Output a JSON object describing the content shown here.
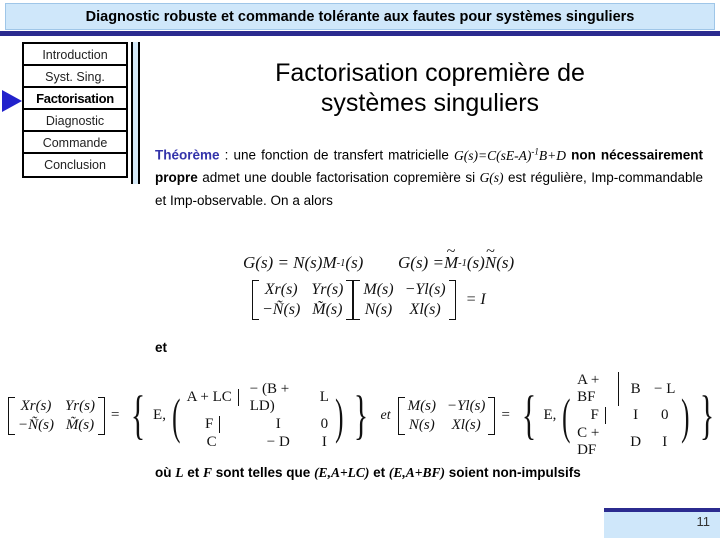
{
  "header": {
    "title": "Diagnostic robuste et commande tolérante aux fautes pour systèmes singuliers",
    "band_color": "#cfe7fa",
    "rule_color": "#2b2b8f"
  },
  "sidebar": {
    "pointer_color": "#2222cc",
    "items": [
      {
        "label": "Introduction",
        "active": false
      },
      {
        "label": "Syst. Sing.",
        "active": false
      },
      {
        "label": "Factorisation",
        "active": true
      },
      {
        "label": "Diagnostic",
        "active": false
      },
      {
        "label": "Commande",
        "active": false
      },
      {
        "label": "Conclusion",
        "active": false
      }
    ]
  },
  "main": {
    "title_line1": "Factorisation copremière de",
    "title_line2": "systèmes singuliers",
    "theorem": {
      "label": "Théorème",
      "label_color": "#3333aa",
      "colon": " : ",
      "seg1": "une fonction de transfert matricielle ",
      "formula_inline_1": "G(s)=C(sE-A)",
      "formula_inline_1_exp": "-1",
      "formula_inline_1_tail": "B+D",
      "seg2_bold": "non nécessairement propre",
      "seg3": " admet une double factorisation copremière si ",
      "formula_inline_2": "G(s)",
      "seg4": " est régulière, Imp-commandable et Imp-observable. On a alors"
    },
    "connector_et": "et",
    "note": {
      "pre": "où ",
      "sym_L": "L",
      "mid1": " et ",
      "sym_F": "F",
      "mid2": " sont telles que ",
      "cond1": "(E,A+LC)",
      "mid3": " et ",
      "cond2": "(E,A+BF)",
      "post": " soient non-impulsifs"
    }
  },
  "equations": {
    "eq1_left": "G(s) = N(s)M",
    "eq1_left_exp": "-1",
    "eq1_left_tail": "(s)",
    "eq1_right_prefix": "G(s) = ",
    "eq1_right_M": "M",
    "eq1_right_exp": "-1",
    "eq1_right_mid": "(s)",
    "eq1_right_N": "N",
    "eq1_right_tail": "(s)",
    "eq2": {
      "m1": [
        [
          "X",
          "r",
          "(s)"
        ],
        [
          "Y",
          "r",
          "(s)"
        ],
        [
          "−Ñ",
          "",
          "(s)"
        ],
        [
          "M̃",
          "",
          "(s)"
        ]
      ],
      "m1_cells": [
        "Xr(s)",
        "Yr(s)",
        "−Ñ(s)",
        "M̃(s)"
      ],
      "m2_cells": [
        "M(s)",
        "−Yl(s)",
        "N(s)",
        "Xl(s)"
      ],
      "equals": "= I"
    },
    "eq3": {
      "lhs_cells": [
        "Xr(s)",
        "Yr(s)",
        "−Ñ(s)",
        "M̃(s)"
      ],
      "equals": "=",
      "E_label": "E,",
      "matrix": [
        [
          "A + LC",
          "− (B + LD)",
          "L"
        ],
        [
          "F",
          "I",
          "0"
        ],
        [
          "C",
          "− D",
          "I"
        ]
      ],
      "connector": "et",
      "rhs_cells": [
        "M(s)",
        "−Yl(s)",
        "N(s)",
        "Xl(s)"
      ],
      "equals2": "=",
      "E_label2": "E,",
      "matrix2": [
        [
          "A + BF",
          "B",
          "− L"
        ],
        [
          "F",
          "I",
          "0"
        ],
        [
          "C + DF",
          "D",
          "I"
        ]
      ]
    }
  },
  "footer": {
    "page_number": "11",
    "band_color": "#cfe7fa",
    "rule_color": "#2b2b8f"
  }
}
